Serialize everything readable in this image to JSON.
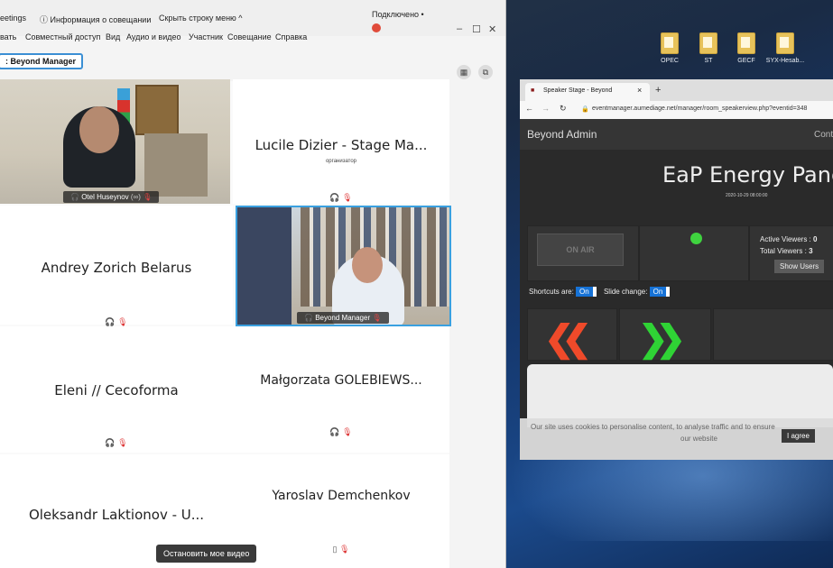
{
  "desktop": {
    "icons": [
      {
        "label": "OPEC",
        "icon": "folder-icon"
      },
      {
        "label": "ST",
        "icon": "folder-icon"
      },
      {
        "label": "GECF",
        "icon": "folder-icon"
      },
      {
        "label": "SYX-Hesab...",
        "icon": "folder-icon"
      }
    ]
  },
  "meeting": {
    "title_app": "eetings",
    "info_label": "Информация о совещании",
    "hide_menu_label": "Скрыть строку меню ^",
    "connection_status": "Подключено",
    "menu": [
      "вать",
      "Совместный доступ",
      "Вид",
      "Аудио и видео",
      "Участник",
      "Совещание",
      "Справка"
    ],
    "presenter_label": ": Beyond Manager",
    "participants": [
      {
        "name": "Otel Huseynov",
        "has_video": true
      },
      {
        "name": "Lucile Dizier - Stage Ma...",
        "role": "организатор"
      },
      {
        "name": "Andrey Zorich Belarus"
      },
      {
        "name": "Beyond Manager",
        "has_video": true
      },
      {
        "name": "Eleni // Cecoforma"
      },
      {
        "name": "Małgorzata GOLEBIEWS..."
      },
      {
        "name": "Oleksandr Laktionov - U..."
      },
      {
        "name": "Yaroslav Demchenkov"
      }
    ],
    "stop_video_label": "Остановить мое видео"
  },
  "browser": {
    "tab_title": "Speaker Stage - Beyond",
    "new_tab": "+",
    "url": "eventmanager.aumediage.net/manager/room_speakerview.php?eventid=348",
    "site_user": "Beyond Admin",
    "site_right": "Cont",
    "event_title": "EaP Energy Pane",
    "event_date": "2020-10-29 08:00:00",
    "on_air_label": "ON AIR",
    "active_viewers_label": "Active Viewers :",
    "active_viewers": "0",
    "total_viewers_label": "Total Viewers  :",
    "total_viewers": "3",
    "show_users_label": "Show Users",
    "shortcuts_label": "Shortcuts are:",
    "shortcuts_state": "On",
    "slide_change_label": "Slide change:",
    "slide_change_state": "On",
    "cookie_text_1": "Our site uses cookies to personalise content, to analyse traffic and to ensure",
    "cookie_text_2": "our website",
    "cookie_agree": "I agree",
    "colors": {
      "prev": "#ef4a2a",
      "next": "#2fd335",
      "status_dot": "#3fd33f",
      "toggle": "#1672d6"
    }
  }
}
